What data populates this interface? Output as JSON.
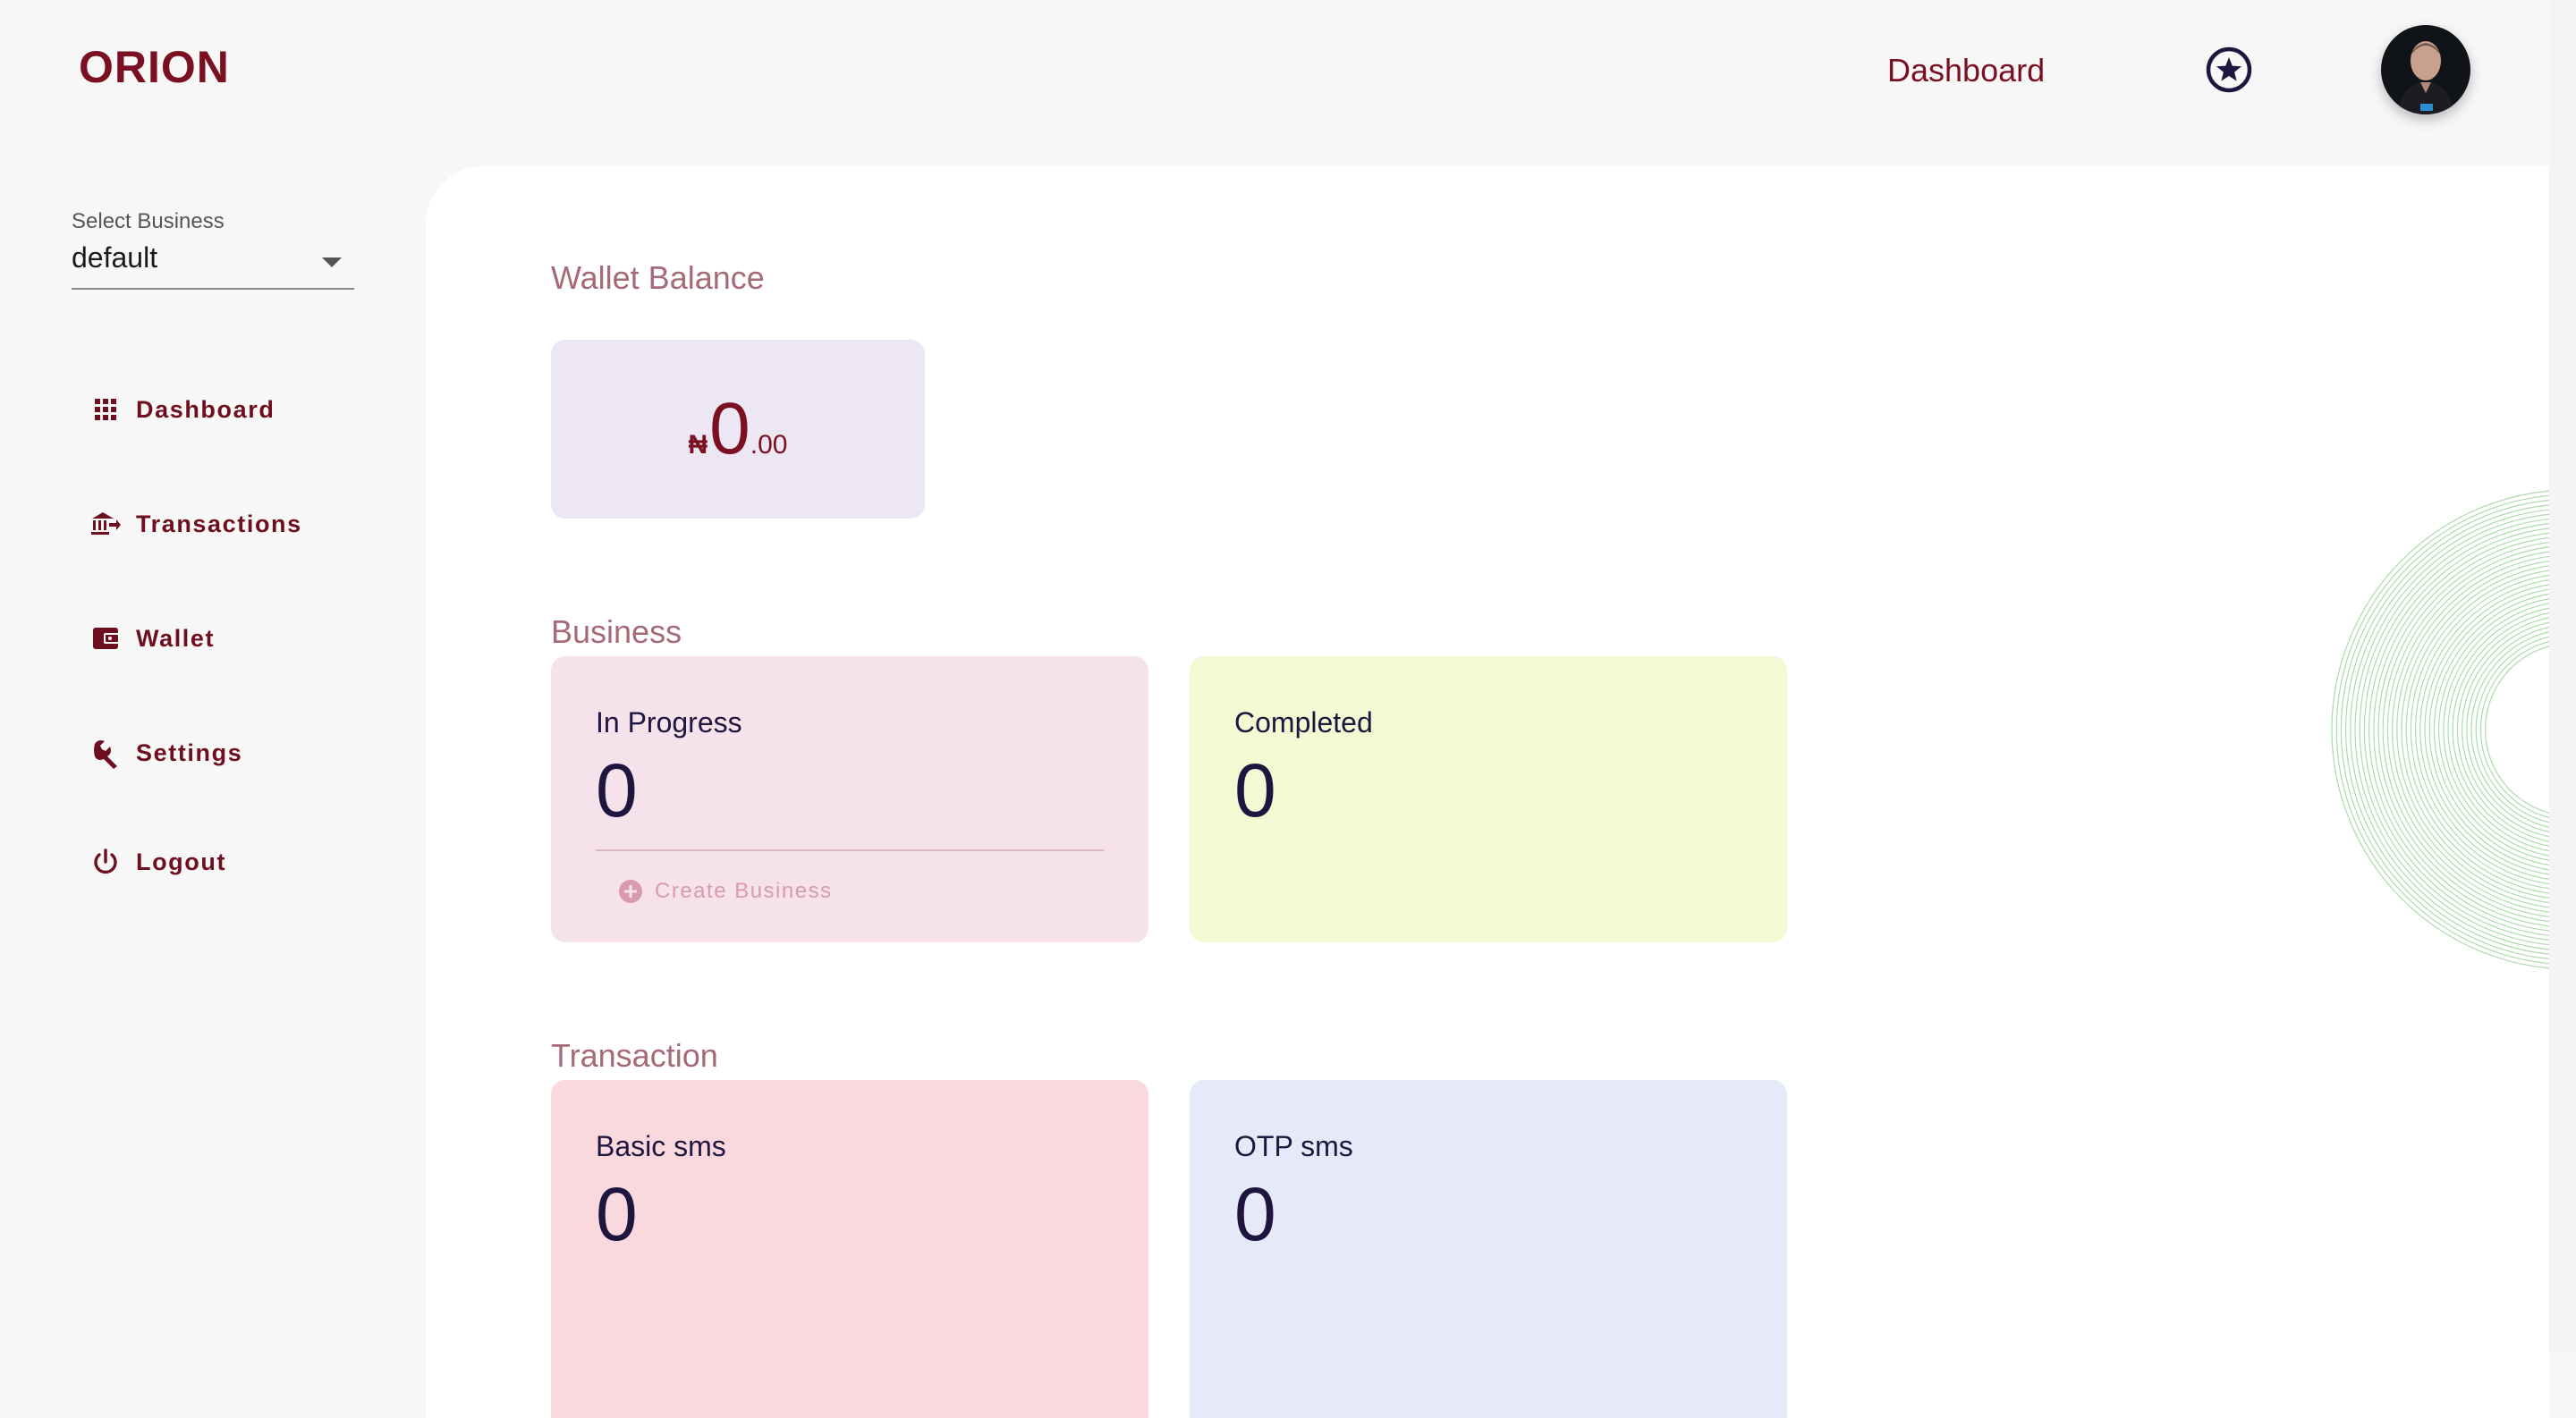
{
  "app": {
    "logo": "ORION"
  },
  "header": {
    "nav_dashboard": "Dashboard"
  },
  "sidebar": {
    "select_label": "Select Business",
    "select_value": "default",
    "items": [
      {
        "label": "Dashboard",
        "icon": "grid-icon"
      },
      {
        "label": "Transactions",
        "icon": "bank-transfer-icon"
      },
      {
        "label": "Wallet",
        "icon": "wallet-icon"
      },
      {
        "label": "Settings",
        "icon": "wrench-icon"
      },
      {
        "label": "Logout",
        "icon": "power-icon"
      }
    ]
  },
  "main": {
    "wallet": {
      "title": "Wallet Balance",
      "currency": "₦",
      "integer": "0",
      "decimal": ".00"
    },
    "business": {
      "title": "Business",
      "in_progress": {
        "label": "In Progress",
        "value": "0",
        "action": "Create Business"
      },
      "completed": {
        "label": "Completed",
        "value": "0"
      }
    },
    "transaction": {
      "title": "Transaction",
      "basic": {
        "label": "Basic sms",
        "value": "0"
      },
      "otp": {
        "label": "OTP sms",
        "value": "0"
      }
    }
  },
  "colors": {
    "brand": "#7a1022",
    "wallet_card": "#ece7f3",
    "in_progress_card": "#f6e2ea",
    "completed_card": "#f3f9d2",
    "basic_sms_card": "#f9d9dd",
    "otp_sms_card": "#e6eaf8"
  }
}
